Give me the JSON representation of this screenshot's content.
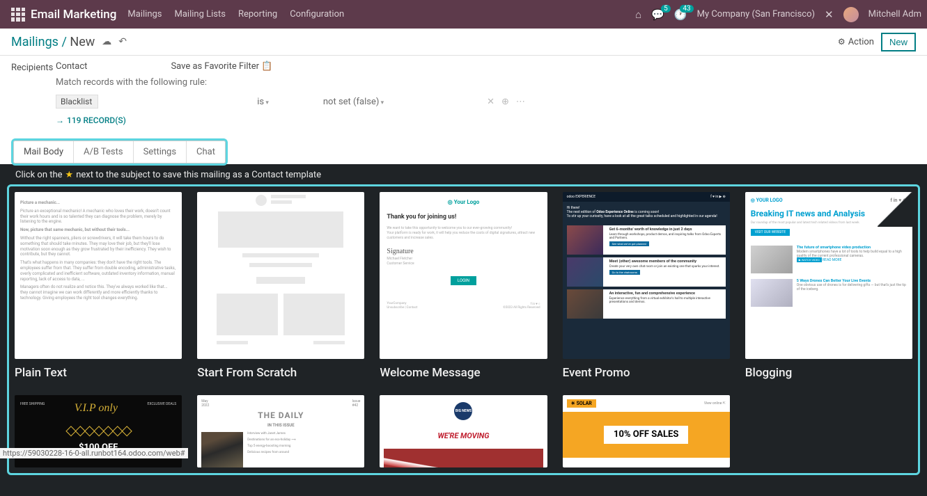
{
  "navbar": {
    "brand": "Email Marketing",
    "menu": [
      "Mailings",
      "Mailing Lists",
      "Reporting",
      "Configuration"
    ],
    "messages_badge": "5",
    "activities_badge": "43",
    "company": "My Company (San Francisco)",
    "username": "Mitchell Adm"
  },
  "breadcrumb": {
    "parent": "Mailings",
    "current": "New",
    "action_label": "Action",
    "new_label": "New"
  },
  "form": {
    "recipients_label": "Recipients",
    "recipients_value": "Contact",
    "save_filter": "Save as Favorite Filter",
    "rule_text": "Match records with the following rule:",
    "rule_field": "Blacklist",
    "rule_op": "is",
    "rule_value": "not set (false)",
    "records_link": "119 RECORD(S)"
  },
  "tabs": [
    "Mail Body",
    "A/B Tests",
    "Settings",
    "Chat"
  ],
  "hint_prefix": "Click on the",
  "hint_suffix": "next to the subject to save this mailing as a Contact template",
  "templates_row1": [
    {
      "title": "Plain Text"
    },
    {
      "title": "Start From Scratch"
    },
    {
      "title": "Welcome Message"
    },
    {
      "title": "Event Promo"
    },
    {
      "title": "Blogging"
    }
  ],
  "templates_row2_visible": true,
  "welcome": {
    "logo": "◎ Your Logo",
    "heading": "Thank you for joining us!",
    "login": "LOGIN"
  },
  "blog": {
    "logo": "◎ YOUR LOGO",
    "title": "Breaking IT news and Analysis",
    "button": "VISIT OUR WEBSITE",
    "p1": "The future of smartphone video production",
    "p2": "5 Ways Drones Can Better Your Live Events"
  },
  "event": {
    "brand": "odoo EXPERIENCE",
    "r1": "Get 6-months' worth of knowledge in just 2 days",
    "r2": "Meet (other) awesome members of the community",
    "r3": "An interactive, fun and comprehensive experience"
  },
  "vip": {
    "left": "FREE SHIPPING",
    "center": "V.I.P only",
    "right": "EXCLUSIVE DEALS",
    "off": "$100 OFF"
  },
  "daily": {
    "title": "THE DAILY",
    "issue": "IN THIS ISSUE"
  },
  "moving": {
    "logo": "BIG NEWS",
    "title": "WE'RE MOVING"
  },
  "solar": {
    "logo": "☀ SOLAR",
    "view": "View online ⇱",
    "off": "10% OFF SALES"
  },
  "url_hint": "https://59030228-16-0-all.runbot164.odoo.com/web#"
}
